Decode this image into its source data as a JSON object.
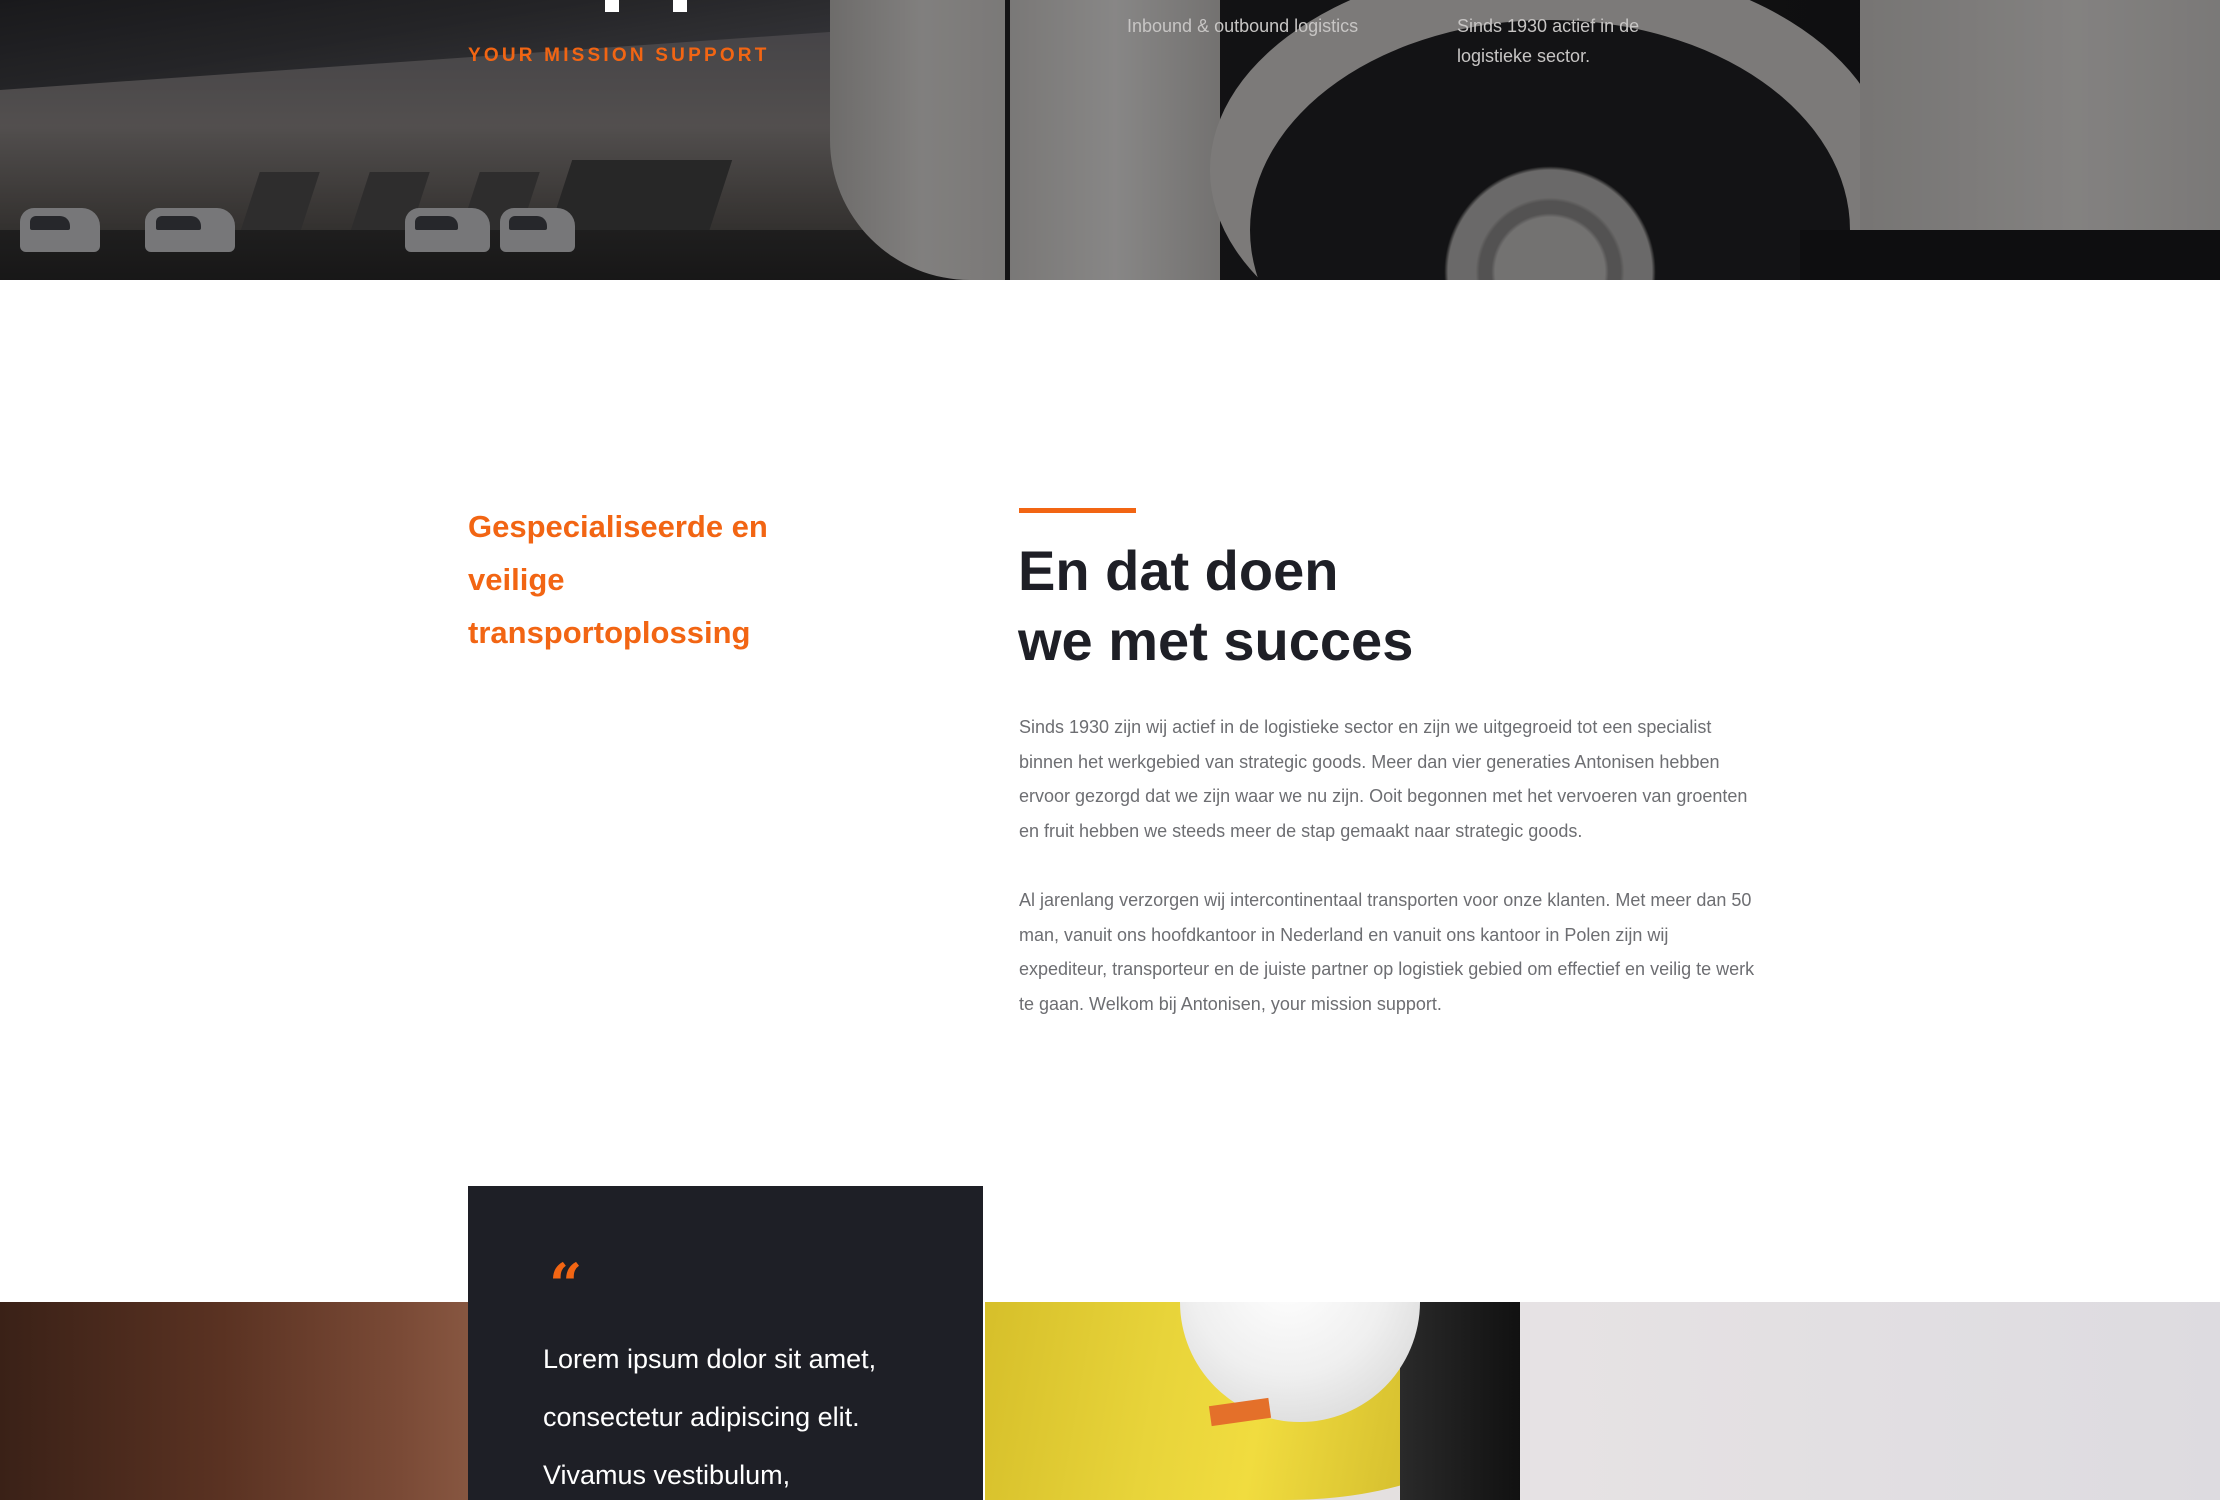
{
  "hero": {
    "tagline": "YOUR MISSION SUPPORT",
    "features": [
      {
        "text": "Inbound & outbound logistics"
      },
      {
        "text": "Sinds 1930 actief in de logistieke sector."
      }
    ]
  },
  "intro": {
    "side_heading": "Gespecialiseerde en veilige transportoplossing",
    "title_line1": "En dat doen",
    "title_line2": "we met succes",
    "paragraphs": [
      "Sinds 1930 zijn wij actief in de logistieke sector en zijn we uitgegroeid tot een specialist binnen het werkgebied van strategic goods. Meer dan vier generaties Antonisen hebben ervoor gezorgd dat we zijn waar we nu zijn. Ooit begonnen met het vervoeren van groenten en fruit hebben we steeds meer de stap gemaakt naar strategic goods.",
      "Al jarenlang verzorgen wij intercontinentaal transporten voor onze klanten. Met meer dan 50 man, vanuit ons hoofdkantoor in Nederland en vanuit ons kantoor in Polen zijn wij expediteur, transporteur en de juiste partner op logistiek gebied om effectief en veilig te werk te gaan. Welkom bij Antonisen, your mission support."
    ]
  },
  "quote": {
    "mark": "“",
    "text": "Lorem ipsum dolor sit amet, consectetur adipiscing elit. Vivamus vestibulum,"
  },
  "colors": {
    "accent": "#f26513",
    "dark": "#1e1f26",
    "body_text": "#6d6e72"
  }
}
